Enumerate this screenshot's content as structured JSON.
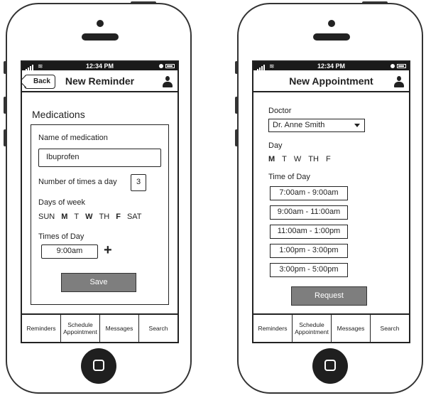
{
  "status_bar": {
    "time": "12:34 PM"
  },
  "reminder_screen": {
    "back_label": "Back",
    "title": "New Reminder",
    "section_title": "Medications",
    "name_label": "Name of medication",
    "name_value": "Ibuprofen",
    "times_label": "Number of times a day",
    "times_value": "3",
    "days_label": "Days of week",
    "days": [
      {
        "label": "SUN",
        "selected": false
      },
      {
        "label": "M",
        "selected": true
      },
      {
        "label": "T",
        "selected": false
      },
      {
        "label": "W",
        "selected": true
      },
      {
        "label": "TH",
        "selected": false
      },
      {
        "label": "F",
        "selected": true
      },
      {
        "label": "SAT",
        "selected": false
      }
    ],
    "time_of_day_label": "Times of Day",
    "time_value": "9:00am",
    "add_symbol": "+",
    "save_label": "Save"
  },
  "appointment_screen": {
    "title": "New Appointment",
    "doctor_label": "Doctor",
    "doctor_value": "Dr. Anne Smith",
    "day_label": "Day",
    "days": [
      {
        "label": "M",
        "selected": true
      },
      {
        "label": "T",
        "selected": false
      },
      {
        "label": "W",
        "selected": false
      },
      {
        "label": "TH",
        "selected": false
      },
      {
        "label": "F",
        "selected": false
      }
    ],
    "time_label": "Time of Day",
    "slots": [
      "7:00am - 9:00am",
      "9:00am - 11:00am",
      "11:00am - 1:00pm",
      "1:00pm - 3:00pm",
      "3:00pm - 5:00pm"
    ],
    "request_label": "Request"
  },
  "tabs": [
    "Reminders",
    "Schedule Appointment",
    "Messages",
    "Search"
  ],
  "colors": {
    "button_gray": "#7e7e7e",
    "outline": "#222222",
    "screen_bg": "#ffffff"
  }
}
